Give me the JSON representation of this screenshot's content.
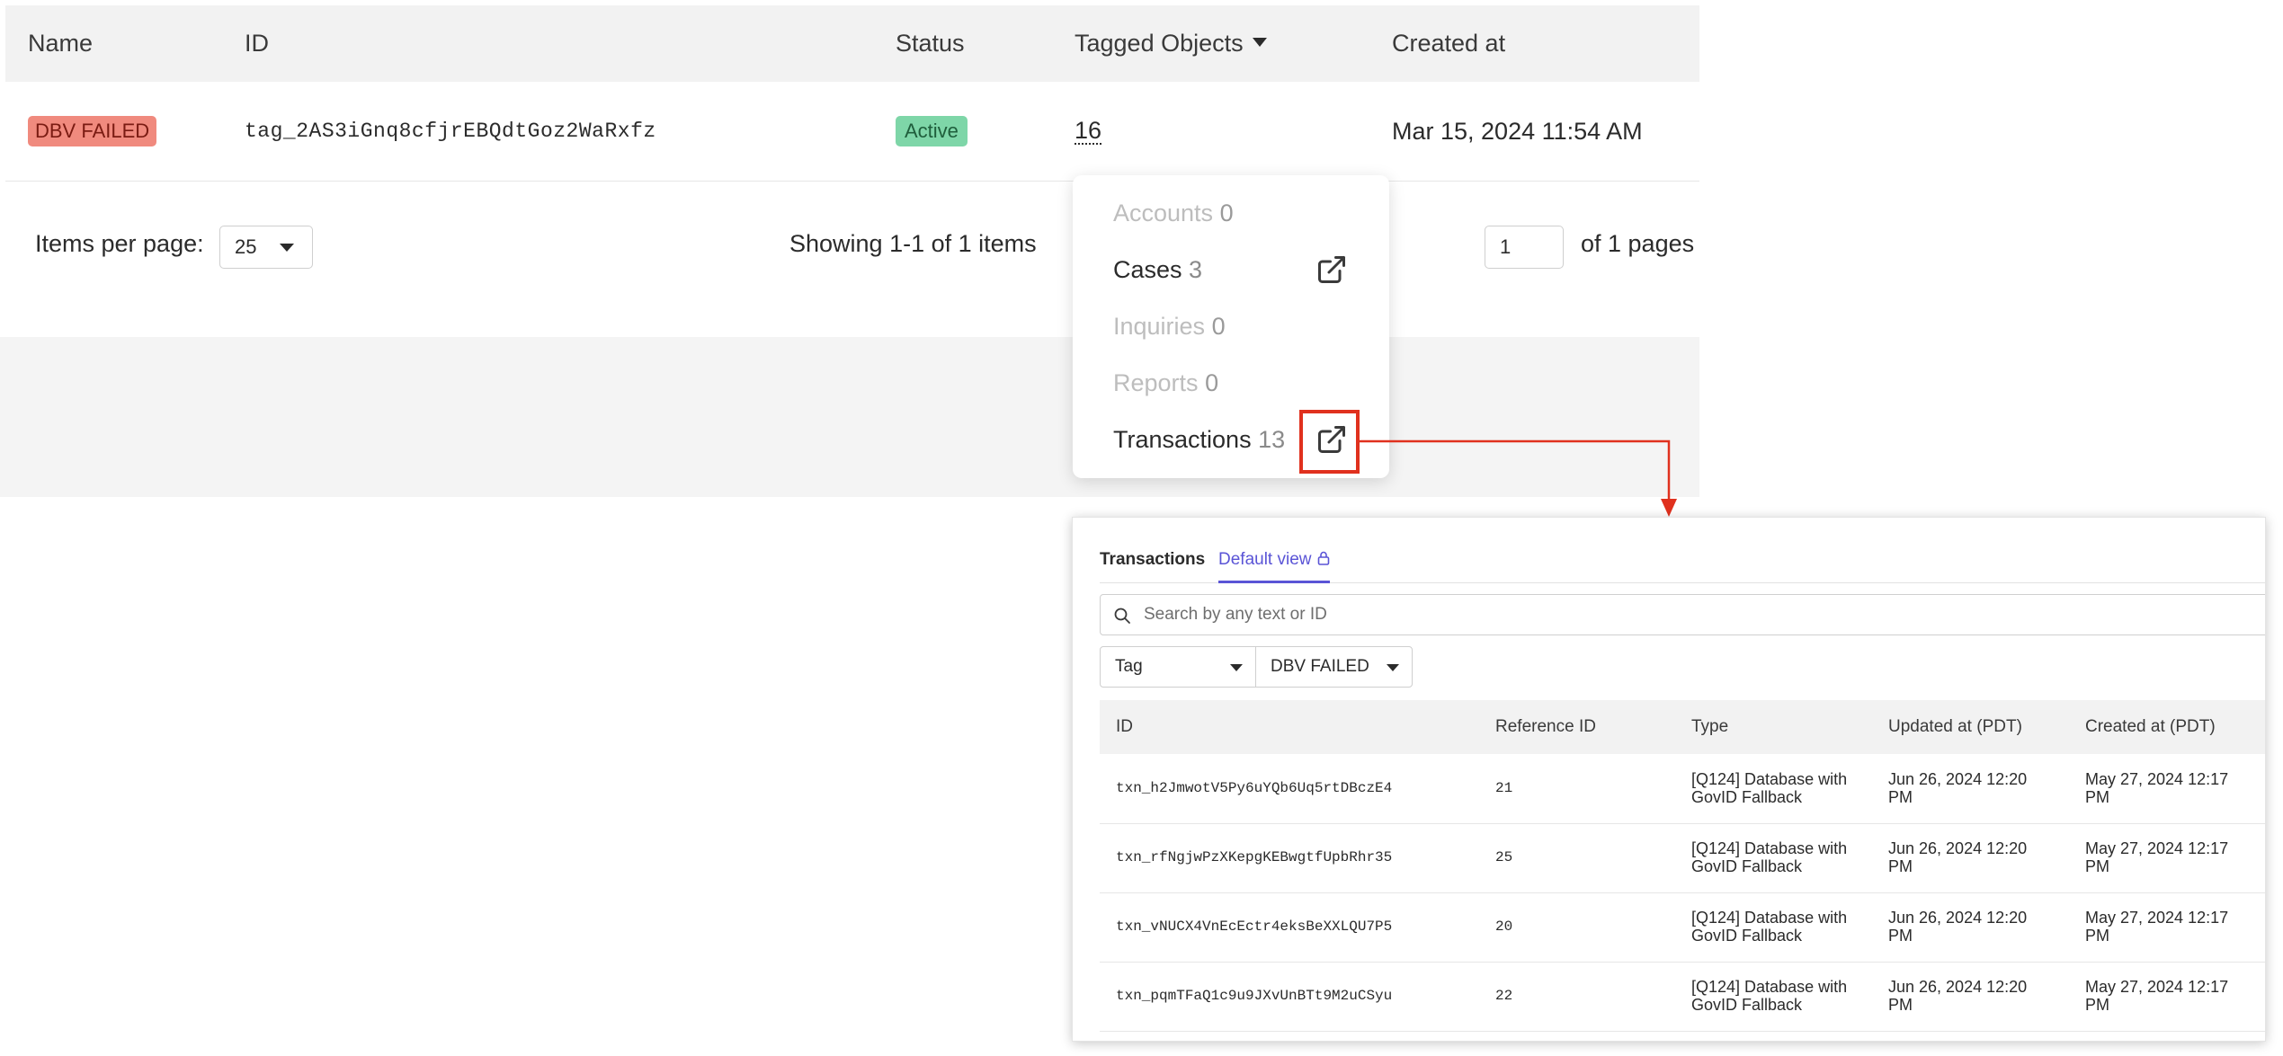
{
  "tag_table": {
    "headers": {
      "name": "Name",
      "id": "ID",
      "status": "Status",
      "tagged_objects": "Tagged Objects",
      "created_at": "Created at"
    },
    "row": {
      "name": "DBV FAILED",
      "id": "tag_2AS3iGnq8cfjrEBQdtGoz2WaRxfz",
      "status": "Active",
      "tagged_objects": "16",
      "created_at": "Mar 15, 2024 11:54 AM"
    },
    "colors": {
      "tag_badge": "#f08a7e",
      "status_badge": "#7ed6a8"
    }
  },
  "pagination": {
    "items_per_page_label": "Items per page:",
    "items_per_page_value": "25",
    "showing": "Showing 1-1 of 1 items",
    "page_value": "1",
    "of_pages": "of 1 pages"
  },
  "popover": {
    "items": [
      {
        "label": "Accounts",
        "count": "0",
        "enabled": false
      },
      {
        "label": "Cases",
        "count": "3",
        "enabled": true,
        "icon": "external-link-icon"
      },
      {
        "label": "Inquiries",
        "count": "0",
        "enabled": false
      },
      {
        "label": "Reports",
        "count": "0",
        "enabled": false
      },
      {
        "label": "Transactions",
        "count": "13",
        "enabled": true,
        "icon": "external-link-icon"
      }
    ],
    "highlight_color": "#e0311e"
  },
  "transactions_panel": {
    "title": "Transactions",
    "view": "Default view",
    "search_placeholder": "Search by any text or ID",
    "filters": {
      "field": "Tag",
      "value": "DBV FAILED"
    },
    "columns": {
      "id": "ID",
      "reference_id": "Reference ID",
      "type": "Type",
      "updated_at": "Updated at (PDT)",
      "created_at": "Created at (PDT)"
    },
    "rows": [
      {
        "id": "txn_h2JmwotV5Py6uYQb6Uq5rtDBczE4",
        "reference_id": "21",
        "type": "[Q124] Database with GovID Fallback",
        "updated_at": "Jun 26, 2024 12:20 PM",
        "created_at": "May 27, 2024 12:17 PM"
      },
      {
        "id": "txn_rfNgjwPzXKepgKEBwgtfUpbRhr35",
        "reference_id": "25",
        "type": "[Q124] Database with GovID Fallback",
        "updated_at": "Jun 26, 2024 12:20 PM",
        "created_at": "May 27, 2024 12:17 PM"
      },
      {
        "id": "txn_vNUCX4VnEcEctr4eksBeXXLQU7P5",
        "reference_id": "20",
        "type": "[Q124] Database with GovID Fallback",
        "updated_at": "Jun 26, 2024 12:20 PM",
        "created_at": "May 27, 2024 12:17 PM"
      },
      {
        "id": "txn_pqmTFaQ1c9u9JXvUnBTt9M2uCSyu",
        "reference_id": "22",
        "type": "[Q124] Database with GovID Fallback",
        "updated_at": "Jun 26, 2024 12:20 PM",
        "created_at": "May 27, 2024 12:17 PM"
      }
    ],
    "accent_color": "#5a54d6"
  }
}
